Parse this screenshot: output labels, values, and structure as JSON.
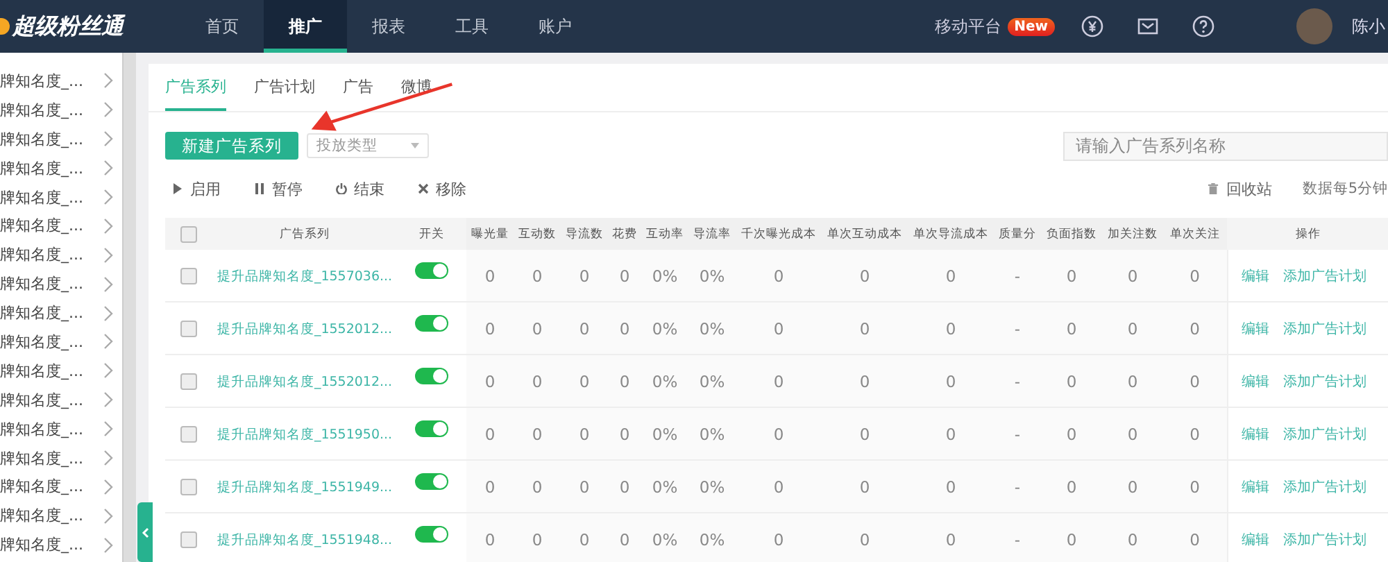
{
  "topbar": {
    "logo": "超级粉丝通",
    "nav": [
      {
        "label": "首页",
        "selected": false
      },
      {
        "label": "推广",
        "selected": true
      },
      {
        "label": "报表",
        "selected": false
      },
      {
        "label": "工具",
        "selected": false
      },
      {
        "label": "账户",
        "selected": false
      }
    ],
    "mobile": "移动平台",
    "badge": "New",
    "user": "陈小"
  },
  "sidebar": {
    "items": [
      "牌知名度_...",
      "牌知名度_...",
      "牌知名度_...",
      "牌知名度_...",
      "牌知名度_...",
      "牌知名度_...",
      "牌知名度_...",
      "牌知名度_...",
      "牌知名度_...",
      "牌知名度_...",
      "牌知名度_...",
      "牌知名度_...",
      "牌知名度_...",
      "牌知名度_...",
      "牌知名度_...",
      "牌知名度_...",
      "牌知名度_..."
    ]
  },
  "tabs": [
    {
      "label": "广告系列",
      "selected": true
    },
    {
      "label": "广告计划",
      "selected": false
    },
    {
      "label": "广告",
      "selected": false
    },
    {
      "label": "微博",
      "selected": false
    }
  ],
  "new_button": "新建广告系列",
  "type_select": {
    "placeholder": "投放类型"
  },
  "search": {
    "placeholder": "请输入广告系列名称"
  },
  "actions": [
    {
      "kind": "play",
      "label": "启用"
    },
    {
      "kind": "pause",
      "label": "暂停"
    },
    {
      "kind": "power",
      "label": "结束"
    },
    {
      "kind": "remove",
      "label": "移除"
    }
  ],
  "recycle": "回收站",
  "refresh_note": "数据每5分钟",
  "table": {
    "select_all_checked": false,
    "columns": [
      "广告系列",
      "开关",
      "曝光量",
      "互动数",
      "导流数",
      "花费",
      "互动率",
      "导流率",
      "千次曝光成本",
      "单次互动成本",
      "单次导流成本",
      "质量分",
      "负面指数",
      "加关注数",
      "单次关注",
      "操作"
    ],
    "rows": [
      {
        "checked": false,
        "name": "提升品牌知名度_1557036...",
        "on": true,
        "values": [
          "0",
          "0",
          "0",
          "0",
          "0%",
          "0%",
          "0",
          "0",
          "0",
          "-",
          "0",
          "0",
          "0"
        ],
        "ops": [
          "编辑",
          "添加广告计划"
        ]
      },
      {
        "checked": false,
        "name": "提升品牌知名度_1552012...",
        "on": true,
        "values": [
          "0",
          "0",
          "0",
          "0",
          "0%",
          "0%",
          "0",
          "0",
          "0",
          "-",
          "0",
          "0",
          "0"
        ],
        "ops": [
          "编辑",
          "添加广告计划"
        ]
      },
      {
        "checked": false,
        "name": "提升品牌知名度_1552012...",
        "on": true,
        "values": [
          "0",
          "0",
          "0",
          "0",
          "0%",
          "0%",
          "0",
          "0",
          "0",
          "-",
          "0",
          "0",
          "0"
        ],
        "ops": [
          "编辑",
          "添加广告计划"
        ]
      },
      {
        "checked": false,
        "name": "提升品牌知名度_1551950...",
        "on": true,
        "values": [
          "0",
          "0",
          "0",
          "0",
          "0%",
          "0%",
          "0",
          "0",
          "0",
          "-",
          "0",
          "0",
          "0"
        ],
        "ops": [
          "编辑",
          "添加广告计划"
        ]
      },
      {
        "checked": false,
        "name": "提升品牌知名度_1551949...",
        "on": true,
        "values": [
          "0",
          "0",
          "0",
          "0",
          "0%",
          "0%",
          "0",
          "0",
          "0",
          "-",
          "0",
          "0",
          "0"
        ],
        "ops": [
          "编辑",
          "添加广告计划"
        ]
      },
      {
        "checked": false,
        "name": "提升品牌知名度_1551948...",
        "on": true,
        "values": [
          "0",
          "0",
          "0",
          "0",
          "0%",
          "0%",
          "0",
          "0",
          "0",
          "-",
          "0",
          "0",
          "0"
        ],
        "ops": [
          "编辑",
          "添加广告计划"
        ]
      }
    ]
  }
}
